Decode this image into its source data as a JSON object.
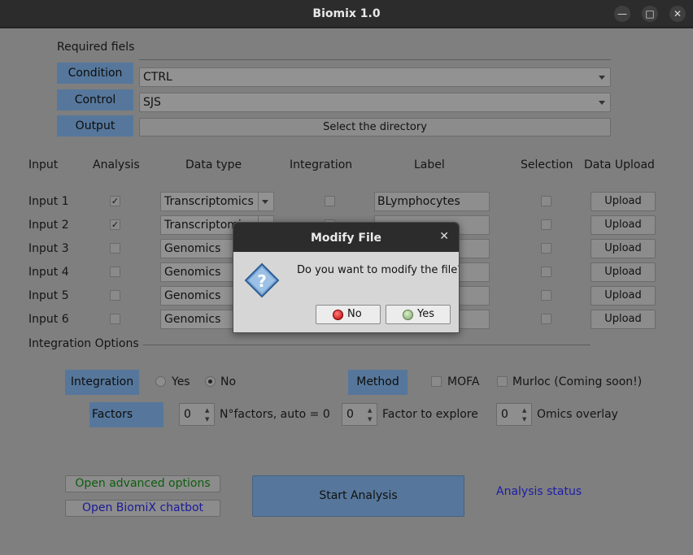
{
  "window": {
    "title": "Biomix 1.0",
    "minimize_glyph": "—",
    "maximize_glyph": "□",
    "close_glyph": "✕"
  },
  "required": {
    "heading": "Required fiels",
    "condition_label": "Condition",
    "condition_value": "CTRL",
    "control_label": "Control",
    "control_value": "SJS",
    "output_label": "Output",
    "output_button": "Select the directory"
  },
  "inputs_header": {
    "input": "Input",
    "analysis": "Analysis",
    "data_type": "Data type",
    "integration": "Integration",
    "label": "Label",
    "selection": "Selection",
    "data_upload": "Data Upload"
  },
  "inputs": [
    {
      "name": "Input 1",
      "analysis": "✓",
      "data_type": "Transcriptomics",
      "label": "BLymphocytes",
      "upload": "Upload"
    },
    {
      "name": "Input 2",
      "analysis": "✓",
      "data_type": "Transcriptomics",
      "label": "",
      "upload": "Upload"
    },
    {
      "name": "Input 3",
      "analysis": "",
      "data_type": "Genomics",
      "label": "",
      "upload": "Upload"
    },
    {
      "name": "Input 4",
      "analysis": "",
      "data_type": "Genomics",
      "label": "",
      "upload": "Upload"
    },
    {
      "name": "Input 5",
      "analysis": "",
      "data_type": "Genomics",
      "label": "",
      "upload": "Upload"
    },
    {
      "name": "Input 6",
      "analysis": "",
      "data_type": "Genomics",
      "label": "",
      "upload": "Upload"
    }
  ],
  "integration_options": {
    "heading": "Integration Options",
    "integration_label": "Integration",
    "yes": "Yes",
    "no": "No",
    "selected": "No",
    "method_label": "Method",
    "mofa": "MOFA",
    "murloc": "Murloc (Coming soon!)",
    "factors_label": "Factors",
    "factors_value": "0",
    "factors_hint": "N°factors, auto = 0",
    "explore_value": "0",
    "explore_hint": "Factor to explore",
    "overlay_value": "0",
    "overlay_hint": "Omics overlay"
  },
  "actions": {
    "advanced": "Open advanced options",
    "chatbot": "Open BiomiX chatbot",
    "start": "Start Analysis",
    "status": "Analysis status"
  },
  "dialog": {
    "title": "Modify File",
    "close_glyph": "✕",
    "message": "Do you want to modify the file?",
    "icon_glyph": "?",
    "no_label": "No",
    "yes_label": "Yes"
  },
  "colors": {
    "label_bg": "#56779b",
    "green_text": "#0e5e0e",
    "blue_text": "#1a1a9a",
    "status_text": "#1c1ca8"
  }
}
